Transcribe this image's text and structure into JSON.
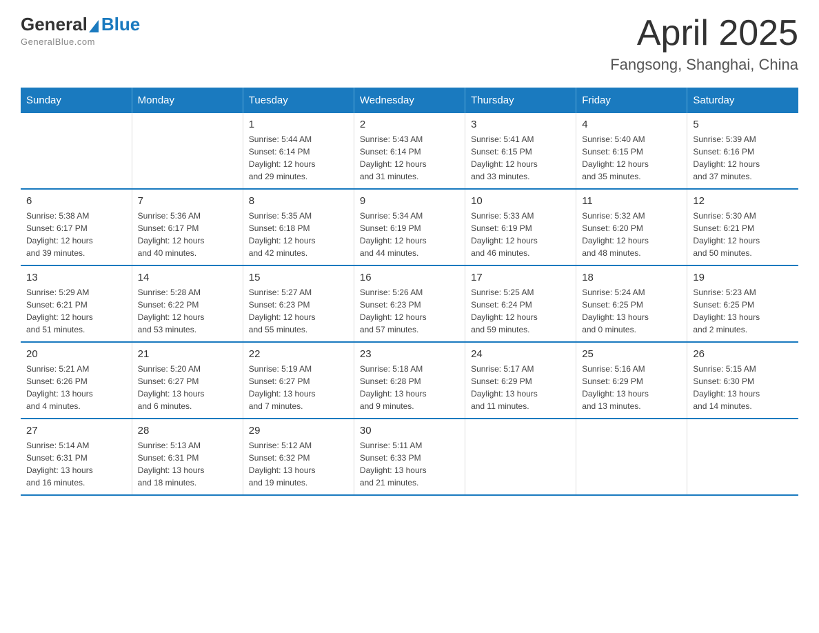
{
  "header": {
    "logo": {
      "general": "General",
      "blue": "Blue",
      "tagline": "GeneralBlue.com"
    },
    "title": "April 2025",
    "subtitle": "Fangsong, Shanghai, China"
  },
  "weekdays": [
    "Sunday",
    "Monday",
    "Tuesday",
    "Wednesday",
    "Thursday",
    "Friday",
    "Saturday"
  ],
  "weeks": [
    [
      {
        "day": "",
        "info": ""
      },
      {
        "day": "",
        "info": ""
      },
      {
        "day": "1",
        "info": "Sunrise: 5:44 AM\nSunset: 6:14 PM\nDaylight: 12 hours\nand 29 minutes."
      },
      {
        "day": "2",
        "info": "Sunrise: 5:43 AM\nSunset: 6:14 PM\nDaylight: 12 hours\nand 31 minutes."
      },
      {
        "day": "3",
        "info": "Sunrise: 5:41 AM\nSunset: 6:15 PM\nDaylight: 12 hours\nand 33 minutes."
      },
      {
        "day": "4",
        "info": "Sunrise: 5:40 AM\nSunset: 6:15 PM\nDaylight: 12 hours\nand 35 minutes."
      },
      {
        "day": "5",
        "info": "Sunrise: 5:39 AM\nSunset: 6:16 PM\nDaylight: 12 hours\nand 37 minutes."
      }
    ],
    [
      {
        "day": "6",
        "info": "Sunrise: 5:38 AM\nSunset: 6:17 PM\nDaylight: 12 hours\nand 39 minutes."
      },
      {
        "day": "7",
        "info": "Sunrise: 5:36 AM\nSunset: 6:17 PM\nDaylight: 12 hours\nand 40 minutes."
      },
      {
        "day": "8",
        "info": "Sunrise: 5:35 AM\nSunset: 6:18 PM\nDaylight: 12 hours\nand 42 minutes."
      },
      {
        "day": "9",
        "info": "Sunrise: 5:34 AM\nSunset: 6:19 PM\nDaylight: 12 hours\nand 44 minutes."
      },
      {
        "day": "10",
        "info": "Sunrise: 5:33 AM\nSunset: 6:19 PM\nDaylight: 12 hours\nand 46 minutes."
      },
      {
        "day": "11",
        "info": "Sunrise: 5:32 AM\nSunset: 6:20 PM\nDaylight: 12 hours\nand 48 minutes."
      },
      {
        "day": "12",
        "info": "Sunrise: 5:30 AM\nSunset: 6:21 PM\nDaylight: 12 hours\nand 50 minutes."
      }
    ],
    [
      {
        "day": "13",
        "info": "Sunrise: 5:29 AM\nSunset: 6:21 PM\nDaylight: 12 hours\nand 51 minutes."
      },
      {
        "day": "14",
        "info": "Sunrise: 5:28 AM\nSunset: 6:22 PM\nDaylight: 12 hours\nand 53 minutes."
      },
      {
        "day": "15",
        "info": "Sunrise: 5:27 AM\nSunset: 6:23 PM\nDaylight: 12 hours\nand 55 minutes."
      },
      {
        "day": "16",
        "info": "Sunrise: 5:26 AM\nSunset: 6:23 PM\nDaylight: 12 hours\nand 57 minutes."
      },
      {
        "day": "17",
        "info": "Sunrise: 5:25 AM\nSunset: 6:24 PM\nDaylight: 12 hours\nand 59 minutes."
      },
      {
        "day": "18",
        "info": "Sunrise: 5:24 AM\nSunset: 6:25 PM\nDaylight: 13 hours\nand 0 minutes."
      },
      {
        "day": "19",
        "info": "Sunrise: 5:23 AM\nSunset: 6:25 PM\nDaylight: 13 hours\nand 2 minutes."
      }
    ],
    [
      {
        "day": "20",
        "info": "Sunrise: 5:21 AM\nSunset: 6:26 PM\nDaylight: 13 hours\nand 4 minutes."
      },
      {
        "day": "21",
        "info": "Sunrise: 5:20 AM\nSunset: 6:27 PM\nDaylight: 13 hours\nand 6 minutes."
      },
      {
        "day": "22",
        "info": "Sunrise: 5:19 AM\nSunset: 6:27 PM\nDaylight: 13 hours\nand 7 minutes."
      },
      {
        "day": "23",
        "info": "Sunrise: 5:18 AM\nSunset: 6:28 PM\nDaylight: 13 hours\nand 9 minutes."
      },
      {
        "day": "24",
        "info": "Sunrise: 5:17 AM\nSunset: 6:29 PM\nDaylight: 13 hours\nand 11 minutes."
      },
      {
        "day": "25",
        "info": "Sunrise: 5:16 AM\nSunset: 6:29 PM\nDaylight: 13 hours\nand 13 minutes."
      },
      {
        "day": "26",
        "info": "Sunrise: 5:15 AM\nSunset: 6:30 PM\nDaylight: 13 hours\nand 14 minutes."
      }
    ],
    [
      {
        "day": "27",
        "info": "Sunrise: 5:14 AM\nSunset: 6:31 PM\nDaylight: 13 hours\nand 16 minutes."
      },
      {
        "day": "28",
        "info": "Sunrise: 5:13 AM\nSunset: 6:31 PM\nDaylight: 13 hours\nand 18 minutes."
      },
      {
        "day": "29",
        "info": "Sunrise: 5:12 AM\nSunset: 6:32 PM\nDaylight: 13 hours\nand 19 minutes."
      },
      {
        "day": "30",
        "info": "Sunrise: 5:11 AM\nSunset: 6:33 PM\nDaylight: 13 hours\nand 21 minutes."
      },
      {
        "day": "",
        "info": ""
      },
      {
        "day": "",
        "info": ""
      },
      {
        "day": "",
        "info": ""
      }
    ]
  ]
}
